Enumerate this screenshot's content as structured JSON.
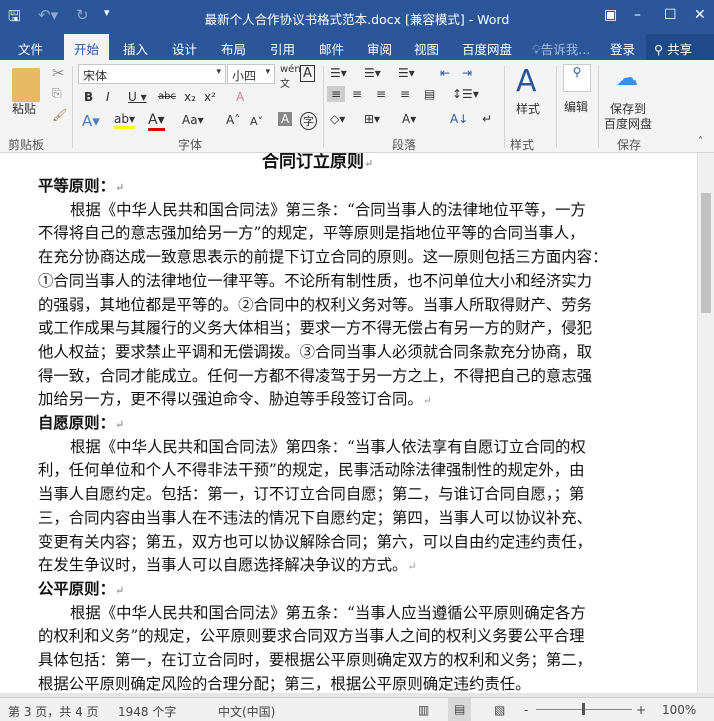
{
  "title": "最新个人合作协议书格式范本.docx [兼容模式] - Word",
  "tabs": [
    "文件",
    "开始",
    "插入",
    "设计",
    "布局",
    "引用",
    "邮件",
    "审阅",
    "视图",
    "百度网盘"
  ],
  "tell_me": "告诉我...",
  "login": "登录",
  "share": "共享",
  "ribbon": {
    "paste": "粘贴",
    "clipboard": "剪贴板",
    "font_name": "宋体",
    "font_size": "小四",
    "font_group": "字体",
    "paragraph_group": "段落",
    "styles": "样式",
    "styles_group": "样式",
    "edit": "编辑",
    "save_to": "保存到",
    "baidu": "百度网盘",
    "save_group": "保存"
  },
  "document": {
    "heading": "合同订立原则",
    "lines": [
      {
        "t": "平等原则：",
        "b": true
      },
      {
        "t": "根据《中华人民共和国合同法》第三条：“合同当事人的法律地位平等，一方",
        "i": true
      },
      {
        "t": "不得将自己的意志强加给另一方”的规定，平等原则是指地位平等的合同当事人，"
      },
      {
        "t": "在充分协商达成一致意思表示的前提下订立合同的原则。这一原则包括三方面内容："
      },
      {
        "t": "①合同当事人的法律地位一律平等。不论所有制性质，也不问单位大小和经济实力"
      },
      {
        "t": "的强弱，其地位都是平等的。②合同中的权利义务对等。当事人所取得财产、劳务"
      },
      {
        "t": "或工作成果与其履行的义务大体相当；要求一方不得无偿占有另一方的财产，侵犯"
      },
      {
        "t": "他人权益；要求禁止平调和无偿调拨。③合同当事人必须就合同条款充分协商，取"
      },
      {
        "t": "得一致，合同才能成立。任何一方都不得凌驾于另一方之上，不得把自己的意志强"
      },
      {
        "t": "加给另一方，更不得以强迫命令、胁迫等手段签订合同。"
      },
      {
        "t": "自愿原则：",
        "b": true
      },
      {
        "t": "根据《中华人民共和国合同法》第四条：“当事人依法享有自愿订立合同的权",
        "i": true
      },
      {
        "t": "利，任何单位和个人不得非法干预”的规定，民事活动除法律强制性的规定外，由"
      },
      {
        "t": "当事人自愿约定。包括：第一，订不订立合同自愿；第二，与谁订合同自愿，；第"
      },
      {
        "t": "三，合同内容由当事人在不违法的情况下自愿约定；第四，当事人可以协议补充、"
      },
      {
        "t": "变更有关内容；第五，双方也可以协议解除合同；第六，可以自由约定违约责任，"
      },
      {
        "t": "在发生争议时，当事人可以自愿选择解决争议的方式。"
      },
      {
        "t": "公平原则：",
        "b": true
      },
      {
        "t": "根据《中华人民共和国合同法》第五条：“当事人应当遵循公平原则确定各方",
        "i": true
      },
      {
        "t": "的权利和义务”的规定，公平原则要求合同双方当事人之间的权利义务要公平合理"
      },
      {
        "t": "具体包括：第一，在订立合同时，要根据公平原则确定双方的权利和义务；第二，"
      },
      {
        "t": "根据公平原则确定风险的合理分配；第三，根据公平原则确定违约责任。"
      }
    ]
  },
  "status": {
    "page": "第 3 页，共 4 页",
    "words": "1948 个字",
    "lang": "中文(中国)",
    "zoom": "100%"
  }
}
